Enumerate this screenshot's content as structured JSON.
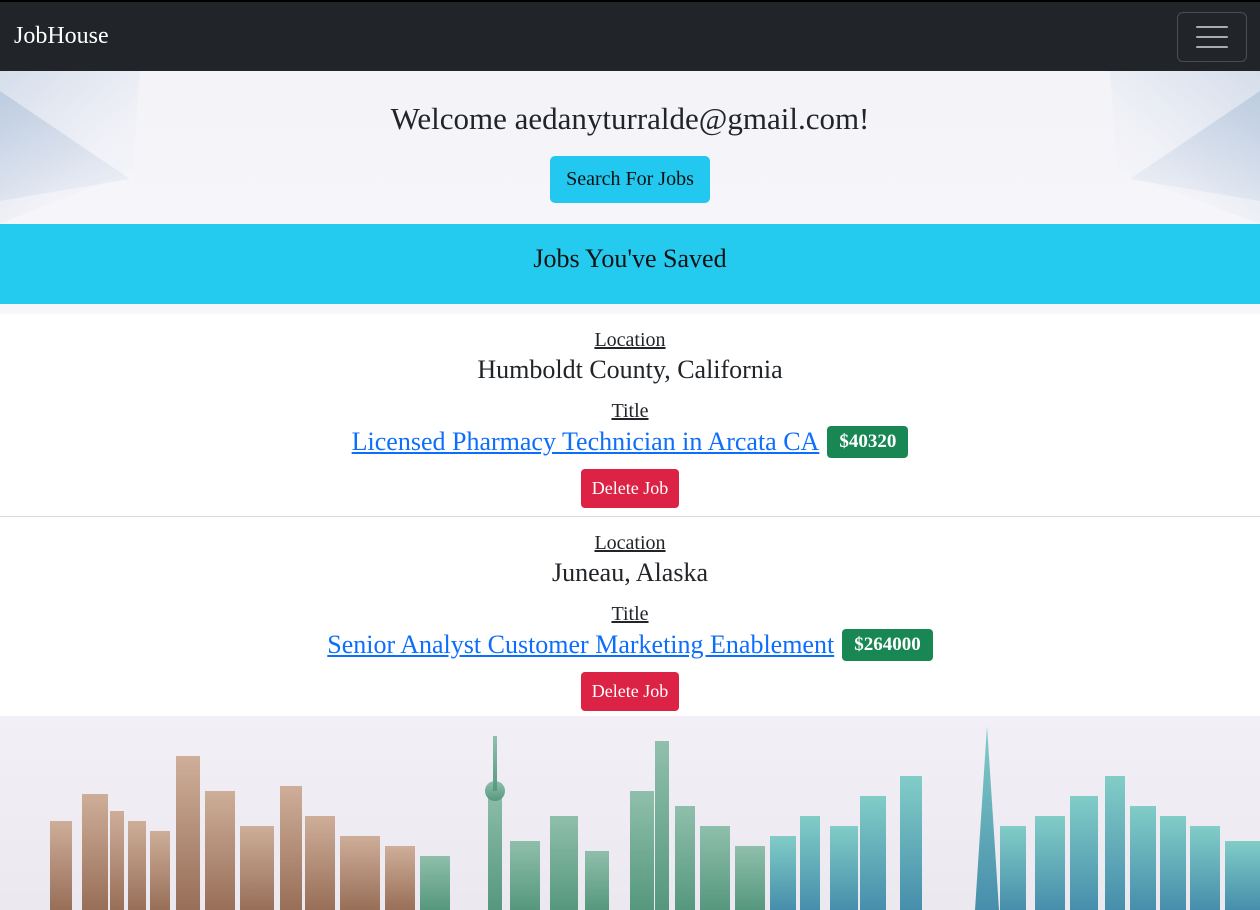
{
  "navbar": {
    "brand": "JobHouse",
    "toggle_icon": "hamburger-menu-icon"
  },
  "hero": {
    "welcome": "Welcome aedanyturralde@gmail.com!",
    "search_button": "Search For Jobs"
  },
  "saved": {
    "heading": "Jobs You've Saved"
  },
  "jobs": [
    {
      "location_label": "Location",
      "location": "Humboldt County, California",
      "title_label": "Title",
      "title": "Licensed Pharmacy Technician in Arcata CA",
      "salary": "$40320",
      "delete_button": "Delete Job"
    },
    {
      "location_label": "Location",
      "location": "Juneau, Alaska",
      "title_label": "Title",
      "title": "Senior Analyst Customer Marketing Enablement",
      "salary": "$264000",
      "delete_button": "Delete Job"
    }
  ],
  "colors": {
    "navbar": "#212529",
    "accent_cyan": "#25caef",
    "salary_badge": "#198754",
    "delete_button": "#dc2345",
    "link": "#0d6efd"
  },
  "footer_image": "city-skyline-illustration"
}
